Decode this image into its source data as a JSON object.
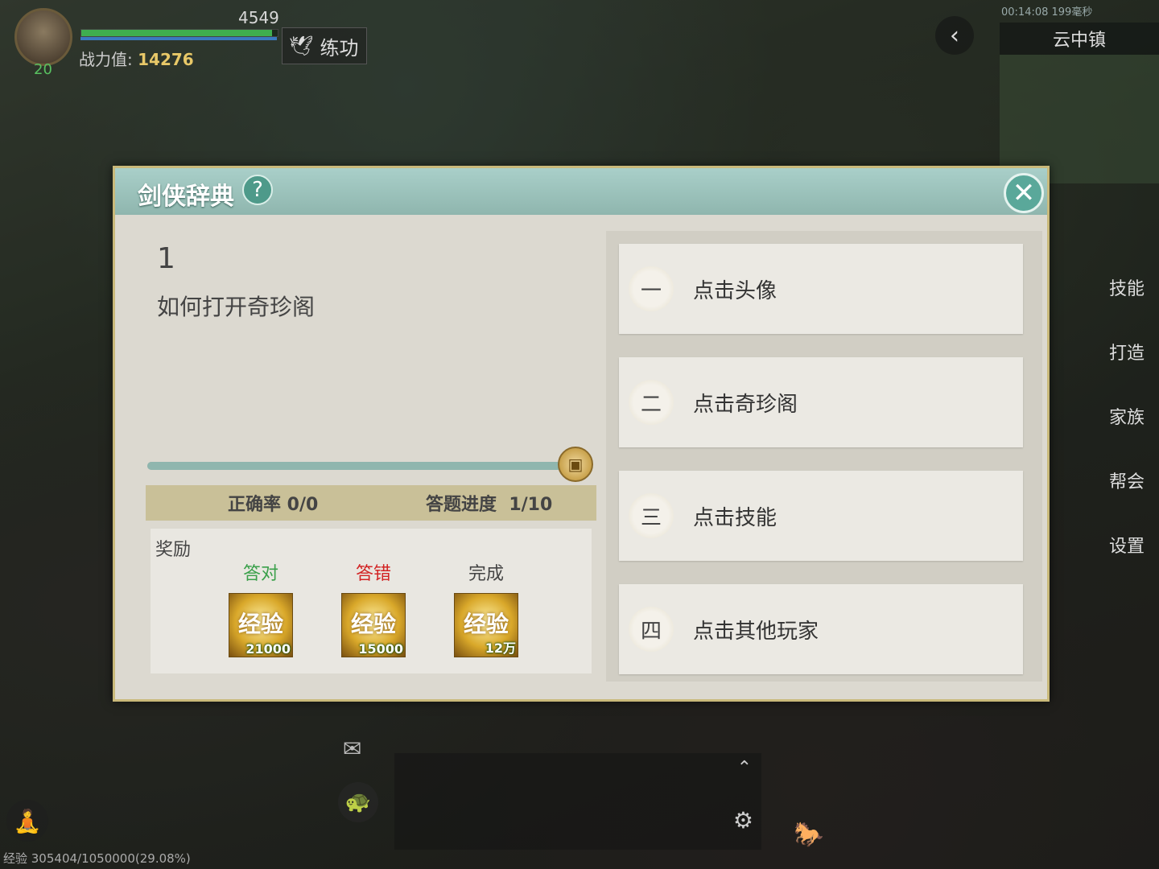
{
  "hud": {
    "level": "20",
    "hp_value": "4549",
    "hp_fill": 0.97,
    "power_label": "战力值:",
    "power_value": "14276",
    "practice_label": "练功",
    "status_time": "00:14:08 199毫秒",
    "town_name": "云中镇",
    "exp_text": "经验 305404/1050000(29.08%)"
  },
  "right_menu": [
    "技能",
    "打造",
    "家族",
    "帮会",
    "设置"
  ],
  "dialog": {
    "title": "剑侠辞典",
    "help_symbol": "?",
    "close_symbol": "✕",
    "question_number": "1",
    "question_text": "如何打开奇珍阁",
    "progress": 1.0,
    "accuracy_label": "正确率 0/0",
    "progress_label": "答题进度",
    "progress_value": "1/10",
    "reward_label": "奖励",
    "rewards": [
      {
        "caption": "答对",
        "caption_color": "#3aa04a",
        "item": "经验",
        "amount": "21000"
      },
      {
        "caption": "答错",
        "caption_color": "#d22424",
        "item": "经验",
        "amount": "15000"
      },
      {
        "caption": "完成",
        "caption_color": "#444444",
        "item": "经验",
        "amount": "12万"
      }
    ],
    "options": [
      {
        "index": "一",
        "label": "点击头像"
      },
      {
        "index": "二",
        "label": "点击奇珍阁"
      },
      {
        "index": "三",
        "label": "点击技能"
      },
      {
        "index": "四",
        "label": "点击其他玩家"
      }
    ]
  },
  "icons": {
    "back": "chevron-left-icon",
    "mail": "mail-icon",
    "settings": "gear-icon",
    "mount": "horse-icon"
  }
}
